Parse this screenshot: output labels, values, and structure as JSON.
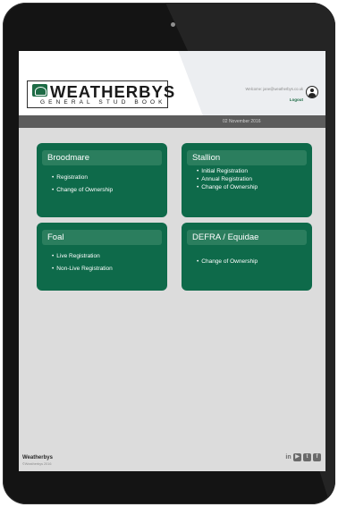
{
  "header": {
    "logo_name": "WEATHERBYS",
    "logo_sub": "GENERAL STUD BOOK",
    "welcome_text": "Welcome: jane@weatherbys.co.uk",
    "logout_label": "Logout",
    "date": "02 November 2016"
  },
  "cards": [
    {
      "title": "Broodmare",
      "items": [
        "Registration",
        "Change of Ownership"
      ]
    },
    {
      "title": "Stallion",
      "items": [
        "Initial Registration",
        "Annual Registration",
        "Change of Ownership"
      ]
    },
    {
      "title": "Foal",
      "items": [
        "Live Registration",
        "Non-Live Registration"
      ]
    },
    {
      "title": "DEFRA / Equidae",
      "items": [
        "Change of Ownership"
      ]
    }
  ],
  "footer": {
    "brand": "Weatherbys",
    "copyright": "©Weatherbys 2016"
  },
  "social": {
    "linkedin": "in",
    "icons": [
      "linkedin-icon",
      "youtube-icon",
      "twitter-icon",
      "facebook-icon"
    ]
  },
  "colors": {
    "brand_green": "#0e6a4a",
    "card_header_green": "#2b7e5e",
    "date_bar": "#5c5c5c",
    "page_bg": "#dcdcdc"
  }
}
